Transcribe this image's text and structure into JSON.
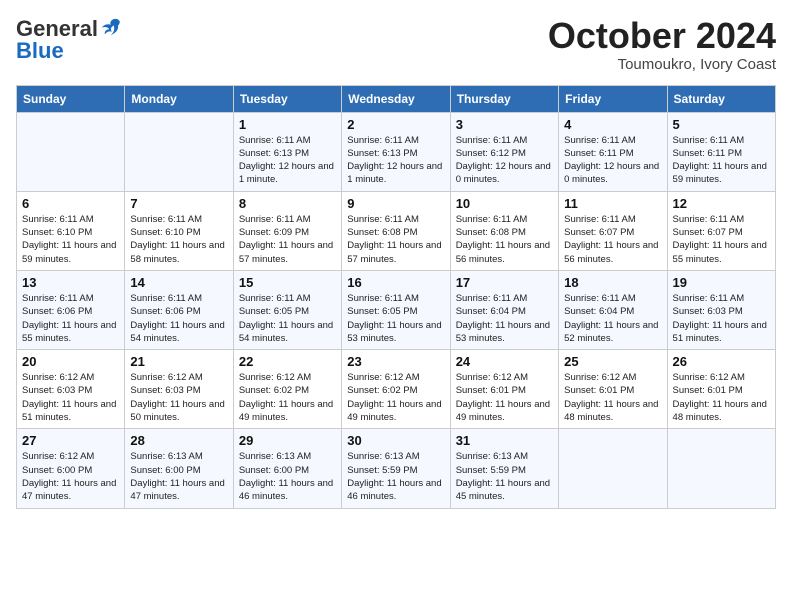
{
  "logo": {
    "general": "General",
    "blue": "Blue"
  },
  "header": {
    "month": "October 2024",
    "location": "Toumoukro, Ivory Coast"
  },
  "days_of_week": [
    "Sunday",
    "Monday",
    "Tuesday",
    "Wednesday",
    "Thursday",
    "Friday",
    "Saturday"
  ],
  "weeks": [
    [
      {
        "day": "",
        "info": ""
      },
      {
        "day": "",
        "info": ""
      },
      {
        "day": "1",
        "info": "Sunrise: 6:11 AM\nSunset: 6:13 PM\nDaylight: 12 hours and 1 minute."
      },
      {
        "day": "2",
        "info": "Sunrise: 6:11 AM\nSunset: 6:13 PM\nDaylight: 12 hours and 1 minute."
      },
      {
        "day": "3",
        "info": "Sunrise: 6:11 AM\nSunset: 6:12 PM\nDaylight: 12 hours and 0 minutes."
      },
      {
        "day": "4",
        "info": "Sunrise: 6:11 AM\nSunset: 6:11 PM\nDaylight: 12 hours and 0 minutes."
      },
      {
        "day": "5",
        "info": "Sunrise: 6:11 AM\nSunset: 6:11 PM\nDaylight: 11 hours and 59 minutes."
      }
    ],
    [
      {
        "day": "6",
        "info": "Sunrise: 6:11 AM\nSunset: 6:10 PM\nDaylight: 11 hours and 59 minutes."
      },
      {
        "day": "7",
        "info": "Sunrise: 6:11 AM\nSunset: 6:10 PM\nDaylight: 11 hours and 58 minutes."
      },
      {
        "day": "8",
        "info": "Sunrise: 6:11 AM\nSunset: 6:09 PM\nDaylight: 11 hours and 57 minutes."
      },
      {
        "day": "9",
        "info": "Sunrise: 6:11 AM\nSunset: 6:08 PM\nDaylight: 11 hours and 57 minutes."
      },
      {
        "day": "10",
        "info": "Sunrise: 6:11 AM\nSunset: 6:08 PM\nDaylight: 11 hours and 56 minutes."
      },
      {
        "day": "11",
        "info": "Sunrise: 6:11 AM\nSunset: 6:07 PM\nDaylight: 11 hours and 56 minutes."
      },
      {
        "day": "12",
        "info": "Sunrise: 6:11 AM\nSunset: 6:07 PM\nDaylight: 11 hours and 55 minutes."
      }
    ],
    [
      {
        "day": "13",
        "info": "Sunrise: 6:11 AM\nSunset: 6:06 PM\nDaylight: 11 hours and 55 minutes."
      },
      {
        "day": "14",
        "info": "Sunrise: 6:11 AM\nSunset: 6:06 PM\nDaylight: 11 hours and 54 minutes."
      },
      {
        "day": "15",
        "info": "Sunrise: 6:11 AM\nSunset: 6:05 PM\nDaylight: 11 hours and 54 minutes."
      },
      {
        "day": "16",
        "info": "Sunrise: 6:11 AM\nSunset: 6:05 PM\nDaylight: 11 hours and 53 minutes."
      },
      {
        "day": "17",
        "info": "Sunrise: 6:11 AM\nSunset: 6:04 PM\nDaylight: 11 hours and 53 minutes."
      },
      {
        "day": "18",
        "info": "Sunrise: 6:11 AM\nSunset: 6:04 PM\nDaylight: 11 hours and 52 minutes."
      },
      {
        "day": "19",
        "info": "Sunrise: 6:11 AM\nSunset: 6:03 PM\nDaylight: 11 hours and 51 minutes."
      }
    ],
    [
      {
        "day": "20",
        "info": "Sunrise: 6:12 AM\nSunset: 6:03 PM\nDaylight: 11 hours and 51 minutes."
      },
      {
        "day": "21",
        "info": "Sunrise: 6:12 AM\nSunset: 6:03 PM\nDaylight: 11 hours and 50 minutes."
      },
      {
        "day": "22",
        "info": "Sunrise: 6:12 AM\nSunset: 6:02 PM\nDaylight: 11 hours and 49 minutes."
      },
      {
        "day": "23",
        "info": "Sunrise: 6:12 AM\nSunset: 6:02 PM\nDaylight: 11 hours and 49 minutes."
      },
      {
        "day": "24",
        "info": "Sunrise: 6:12 AM\nSunset: 6:01 PM\nDaylight: 11 hours and 49 minutes."
      },
      {
        "day": "25",
        "info": "Sunrise: 6:12 AM\nSunset: 6:01 PM\nDaylight: 11 hours and 48 minutes."
      },
      {
        "day": "26",
        "info": "Sunrise: 6:12 AM\nSunset: 6:01 PM\nDaylight: 11 hours and 48 minutes."
      }
    ],
    [
      {
        "day": "27",
        "info": "Sunrise: 6:12 AM\nSunset: 6:00 PM\nDaylight: 11 hours and 47 minutes."
      },
      {
        "day": "28",
        "info": "Sunrise: 6:13 AM\nSunset: 6:00 PM\nDaylight: 11 hours and 47 minutes."
      },
      {
        "day": "29",
        "info": "Sunrise: 6:13 AM\nSunset: 6:00 PM\nDaylight: 11 hours and 46 minutes."
      },
      {
        "day": "30",
        "info": "Sunrise: 6:13 AM\nSunset: 5:59 PM\nDaylight: 11 hours and 46 minutes."
      },
      {
        "day": "31",
        "info": "Sunrise: 6:13 AM\nSunset: 5:59 PM\nDaylight: 11 hours and 45 minutes."
      },
      {
        "day": "",
        "info": ""
      },
      {
        "day": "",
        "info": ""
      }
    ]
  ]
}
